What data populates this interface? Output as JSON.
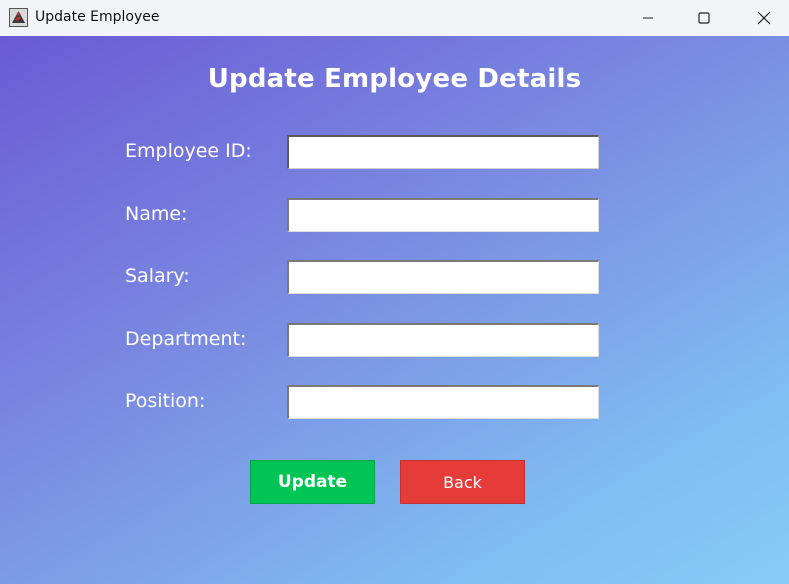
{
  "window": {
    "title": "Update Employee",
    "controls": [
      "minimize",
      "maximize",
      "close"
    ]
  },
  "form": {
    "heading": "Update Employee Details",
    "fields": [
      {
        "label": "Employee ID:",
        "value": "",
        "placeholder": ""
      },
      {
        "label": "Name:",
        "value": "",
        "placeholder": ""
      },
      {
        "label": "Salary:",
        "value": "",
        "placeholder": ""
      },
      {
        "label": "Department:",
        "value": "",
        "placeholder": ""
      },
      {
        "label": "Position:",
        "value": "",
        "placeholder": ""
      }
    ]
  },
  "buttons": {
    "update_label": "Update",
    "back_label": "Back"
  },
  "colors": {
    "update": "#00c454",
    "back": "#e53b39",
    "gradient_start": "#6b5ad6",
    "gradient_end": "#86cbf6"
  }
}
